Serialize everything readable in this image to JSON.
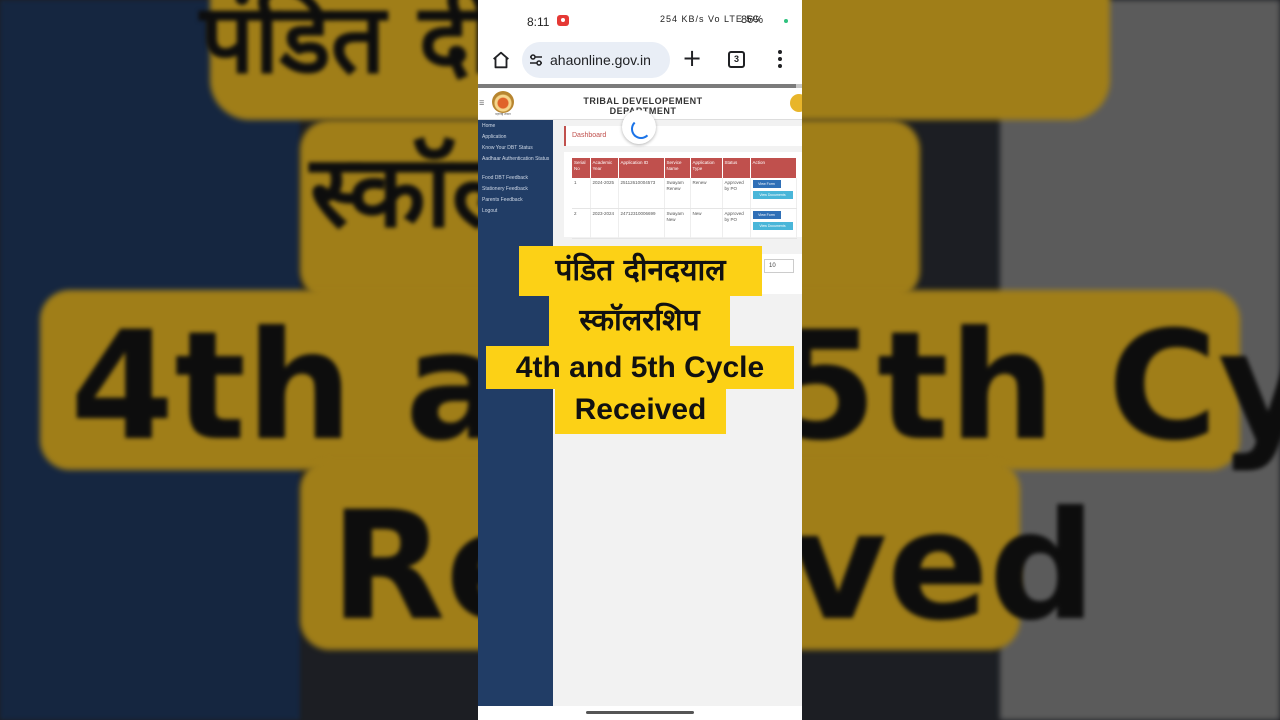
{
  "backdrop": {
    "line1": "पंडित दीनदयाल",
    "line2": "स्कॉलरशिप",
    "line3": "4th and 5th Cycle",
    "line4": "Received"
  },
  "statusbar": {
    "time": "8:11",
    "network": "254 KB/s Vo LTE 5G",
    "battery": "86%"
  },
  "browser": {
    "url": "ahaonline.gov.in",
    "tab_count": "3",
    "page_load_progress": 0.98
  },
  "site": {
    "title": "TRIBAL DEVELOPEMENT DEPARTMENT",
    "logo_caption": "महाराष्ट्र शासन",
    "sidebar": [
      "Home",
      "Application",
      "Know Your DBT Status",
      "Aadhaar Authentication Status",
      "Food DBT Feedback",
      "Stationery Feedback",
      "Parents Feedback",
      "Logout"
    ],
    "breadcrumb": "Dashboard",
    "table": {
      "headers": [
        "Serial No",
        "Academic Year",
        "Application ID",
        "Service Name",
        "Application Type",
        "Status",
        "Action"
      ],
      "rows": [
        {
          "serial": "1",
          "year": "2024-2025",
          "app_id": "25112610004573",
          "service": "Swayam Renew",
          "type": "Renew",
          "status": "Approved by PO",
          "btn1": "View Form",
          "btn2": "View Documents"
        },
        {
          "serial": "2",
          "year": "2023-2024",
          "app_id": "24712310006699",
          "service": "Swayam New",
          "type": "New",
          "status": "Approved by PO",
          "btn1": "View Form",
          "btn2": "View Documents"
        }
      ]
    },
    "page_size": "10"
  },
  "overlay": {
    "line1": "पंडित दीनदयाल",
    "line2": "स्कॉलरशिप",
    "line3": "4th and 5th Cycle",
    "line4": "Received"
  },
  "colors": {
    "caption_bg": "#fcd116",
    "sidebar_bg": "#213d66",
    "table_header": "#c0504d",
    "btn_primary": "#2f6fb7",
    "btn_info": "#49b6d9"
  }
}
